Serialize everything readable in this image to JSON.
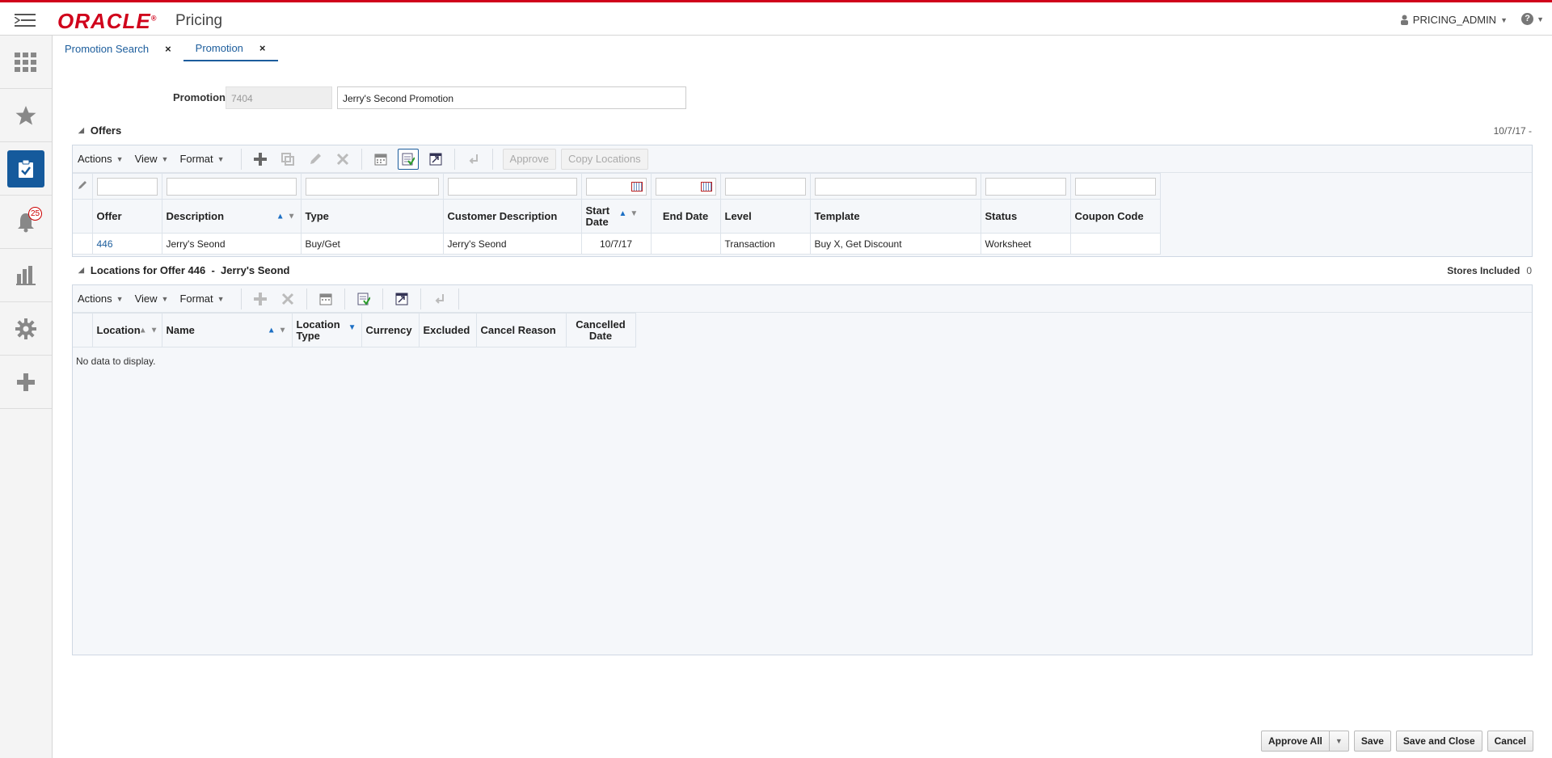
{
  "header": {
    "logo": "ORACLE",
    "app_title": "Pricing",
    "user": "PRICING_ADMIN",
    "help": "?"
  },
  "sidebar": {
    "items": [
      {
        "icon": "grid-icon"
      },
      {
        "icon": "star-icon"
      },
      {
        "icon": "tasks-icon",
        "active": true
      },
      {
        "icon": "bell-icon",
        "badge": "25"
      },
      {
        "icon": "bar-chart-icon"
      },
      {
        "icon": "gear-icon"
      },
      {
        "icon": "plus-icon"
      }
    ]
  },
  "tabs": [
    {
      "label": "Promotion Search",
      "close": "×"
    },
    {
      "label": "Promotion",
      "close": "×"
    }
  ],
  "promotion": {
    "label": "Promotion",
    "id": "7404",
    "name": "Jerry's Second Promotion"
  },
  "offers": {
    "title": "Offers",
    "date": "10/7/17 -",
    "menus": {
      "actions": "Actions",
      "view": "View",
      "format": "Format"
    },
    "buttons": {
      "approve": "Approve",
      "copy_locations": "Copy Locations"
    },
    "columns": [
      "Offer",
      "Description",
      "Type",
      "Customer Description",
      "Start Date",
      "End Date",
      "Level",
      "Template",
      "Status",
      "Coupon Code"
    ],
    "rows": [
      {
        "offer": "446",
        "description": "Jerry's Seond",
        "type": "Buy/Get",
        "customer_description": "Jerry's Seond",
        "start_date": "10/7/17",
        "end_date": "",
        "level": "Transaction",
        "template": "Buy X, Get Discount",
        "status": "Worksheet",
        "coupon_code": ""
      }
    ]
  },
  "locations": {
    "title": "Locations for Offer 446  -  Jerry's Seond",
    "stores_label": "Stores Included",
    "stores_count": "0",
    "menus": {
      "actions": "Actions",
      "view": "View",
      "format": "Format"
    },
    "columns": [
      "Location",
      "Name",
      "Location Type",
      "Currency",
      "Excluded",
      "Cancel Reason",
      "Cancelled Date"
    ],
    "empty": "No data to display."
  },
  "footer": {
    "approve_all": "Approve All",
    "save": "Save",
    "save_close": "Save and Close",
    "cancel": "Cancel"
  }
}
